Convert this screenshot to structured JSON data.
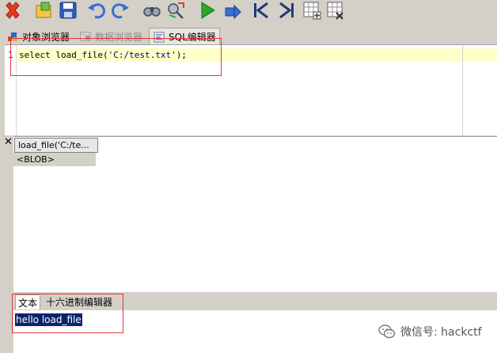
{
  "toolbar": {
    "icons": [
      "delete-icon",
      "open-folder-icon",
      "save-icon",
      "undo-icon",
      "redo-icon",
      "binoculars-icon",
      "find-replace-icon",
      "run-icon",
      "run-selection-icon",
      "first-record-icon",
      "last-record-icon",
      "add-row-icon",
      "delete-row-icon"
    ]
  },
  "tabs": [
    {
      "label": "对象浏览器",
      "icon": "object-browser-icon"
    },
    {
      "label": "数据浏览器",
      "icon": "data-browser-icon"
    },
    {
      "label": "SQL编辑器",
      "icon": "sql-editor-icon"
    }
  ],
  "editor": {
    "line_number": "1",
    "code_prefix": "select load_file(",
    "code_string": "'C:/test.txt'",
    "code_suffix": ");"
  },
  "results": {
    "close_label": "✕",
    "column_header": "load_file('C:/te...",
    "cell_value": "<BLOB>"
  },
  "bottom": {
    "tabs": [
      "文本",
      "十六进制编辑器"
    ],
    "text_value": "hello load_file"
  },
  "watermark": {
    "text": "微信号: hackctf"
  },
  "colors": {
    "highlight_box": "#e4323a",
    "selection_bg": "#0a246a",
    "current_line": "#ffffc8"
  }
}
